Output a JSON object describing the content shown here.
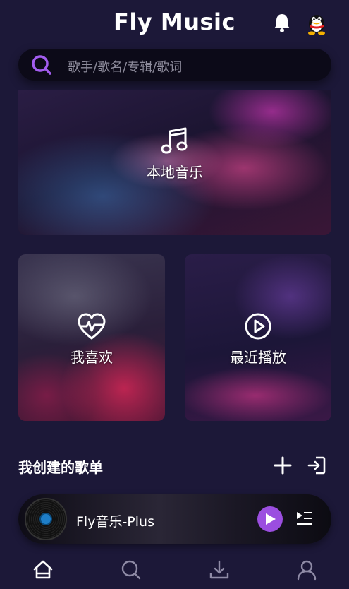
{
  "app": {
    "title": "Fly Music"
  },
  "search": {
    "placeholder": "歌手/歌名/专辑/歌词"
  },
  "cards": {
    "local": {
      "label": "本地音乐",
      "icon": "music-note-icon"
    },
    "favorites": {
      "label": "我喜欢",
      "icon": "heart-pulse-icon"
    },
    "recent": {
      "label": "最近播放",
      "icon": "play-circle-icon"
    }
  },
  "playlists": {
    "title": "我创建的歌单",
    "add_icon": "plus-icon",
    "import_icon": "import-icon"
  },
  "player": {
    "song": "Fly音乐-Plus",
    "play_icon": "play-icon",
    "queue_icon": "playlist-icon"
  },
  "nav": [
    {
      "icon": "home-icon",
      "active": true
    },
    {
      "icon": "search-icon",
      "active": false
    },
    {
      "icon": "download-icon",
      "active": false
    },
    {
      "icon": "user-icon",
      "active": false
    }
  ],
  "colors": {
    "background": "#1c1838",
    "accent": "#9b4ee0",
    "search_icon": "#a35df0"
  }
}
